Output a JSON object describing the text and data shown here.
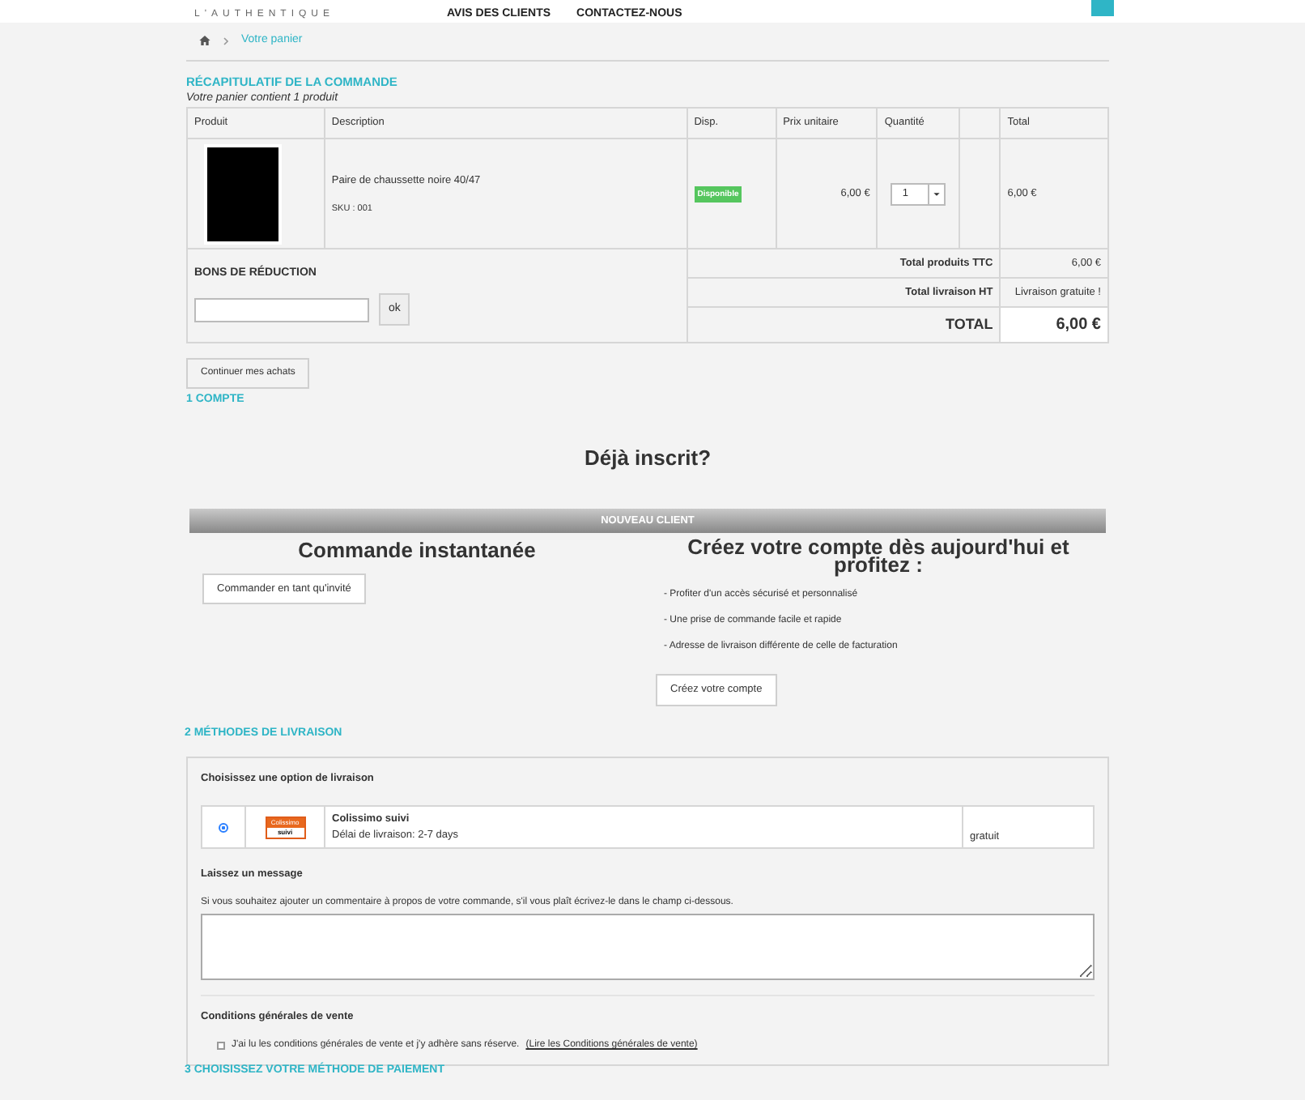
{
  "header": {
    "logo_text": "L'AUTHENTIQUE",
    "nav": [
      "AVIS DES CLIENTS",
      "CONTACTEZ-NOUS"
    ]
  },
  "breadcrumb": {
    "current": "Votre panier"
  },
  "summary": {
    "title": "RÉCAPITULATIF DE LA COMMANDE",
    "subtitle": "Votre panier contient 1 produit",
    "columns": [
      "Produit",
      "Description",
      "Disp.",
      "Prix unitaire",
      "Quantité",
      "Total"
    ],
    "rows": [
      {
        "description": "Paire de chaussette noire 40/47",
        "sku": "SKU : 001",
        "availability": "Disponible",
        "unit_price": "6,00 €",
        "quantity": "1",
        "total": "6,00 €"
      }
    ],
    "voucher": {
      "title": "BONS DE RÉDUCTION",
      "button": "ok"
    },
    "totals": [
      {
        "label": "Total produits TTC",
        "value": "6,00 €",
        "kind": "line"
      },
      {
        "label": "Total livraison HT",
        "value": "Livraison gratuite !",
        "kind": "line"
      },
      {
        "label": "TOTAL",
        "value": "6,00 €",
        "kind": "grand"
      }
    ],
    "continue_button": "Continuer mes achats"
  },
  "account": {
    "step": "1 COMPTE",
    "already": "Déjà inscrit?",
    "new_client": "NOUVEAU CLIENT",
    "guest": {
      "title": "Commande instantanée",
      "button": "Commander en tant qu'invité"
    },
    "create": {
      "title": "Créez votre compte dès aujourd'hui et profitez :",
      "benefits": [
        "- Profiter d'un accès sécurisé et personnalisé",
        "- Une prise de commande facile et rapide",
        "- Adresse de livraison différente de celle de facturation"
      ],
      "button": "Créez votre compte"
    }
  },
  "delivery": {
    "step": "2 MÉTHODES DE LIVRAISON",
    "choose": "Choisissez une option de livraison",
    "carriers": [
      {
        "selected": true,
        "logo_top": "Colissimo",
        "logo_bottom": "suivi",
        "name": "Colissimo suivi",
        "delay": "Délai de livraison: 2-7 days",
        "price": "gratuit"
      }
    ],
    "message_title": "Laissez un message",
    "message_hint": "Si vous souhaitez ajouter un commentaire à propos de votre commande, s'il vous plaît écrivez-le dans le champ ci-dessous.",
    "terms_title": "Conditions générales de vente",
    "terms": {
      "checked": false,
      "label": "J'ai lu les conditions générales de vente et j'y adhère sans réserve.",
      "link": "(Lire les Conditions générales de vente)"
    }
  },
  "payment": {
    "step": "3 CHOISISSEZ VOTRE MÉTHODE DE PAIEMENT"
  }
}
